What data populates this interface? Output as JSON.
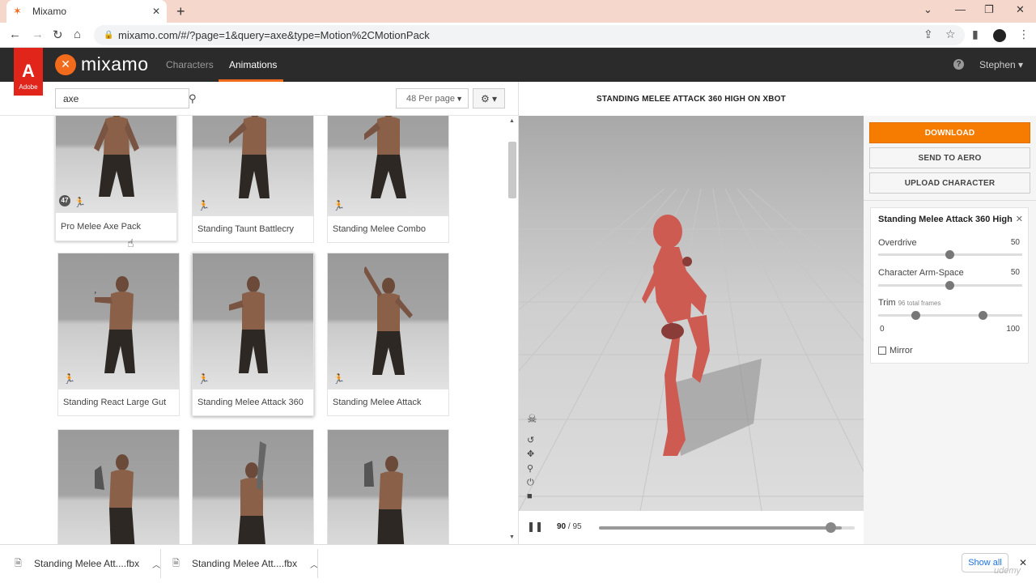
{
  "browser": {
    "tab_title": "Mixamo",
    "url": "mixamo.com/#/?page=1&query=axe&type=Motion%2CMotionPack"
  },
  "header": {
    "adobe_label": "Adobe",
    "logo_text": "mixamo",
    "nav": [
      "Characters",
      "Animations"
    ],
    "user": "Stephen ▾"
  },
  "toolbar": {
    "search_value": "axe",
    "per_page": "48 Per page"
  },
  "grid": {
    "cards": [
      {
        "label": "Pro Melee Axe Pack",
        "badge": "47"
      },
      {
        "label": "Standing Taunt Battlecry"
      },
      {
        "label": "Standing Melee Combo"
      },
      {
        "label": "Standing React Large Gut"
      },
      {
        "label": "Standing Melee Attack 360"
      },
      {
        "label": "Standing Melee Attack"
      },
      {
        "label": ""
      },
      {
        "label": ""
      },
      {
        "label": ""
      }
    ]
  },
  "viewport": {
    "title": "STANDING MELEE ATTACK 360 HIGH ON XBOT",
    "current_frame": "90",
    "total_frames": "/ 95",
    "progress": 0.95
  },
  "actions": {
    "download": "DOWNLOAD",
    "send_aero": "SEND TO AERO",
    "upload": "UPLOAD CHARACTER"
  },
  "settings": {
    "title": "Standing Melee Attack 360 High",
    "overdrive_label": "Overdrive",
    "overdrive_value": "50",
    "armspace_label": "Character Arm-Space",
    "armspace_value": "50",
    "trim_label": "Trim",
    "trim_note": "96 total frames",
    "trim_min": "0",
    "trim_max": "100",
    "mirror_label": "Mirror"
  },
  "downloads": {
    "items": [
      "Standing Melee Att....fbx",
      "Standing Melee Att....fbx"
    ],
    "show_all": "Show all"
  },
  "watermark": "udemy",
  "colors": {
    "accent": "#f26b1d",
    "download_button": "#f57c00",
    "adobe_red": "#e1251b",
    "header_bg": "#2b2b2b"
  }
}
